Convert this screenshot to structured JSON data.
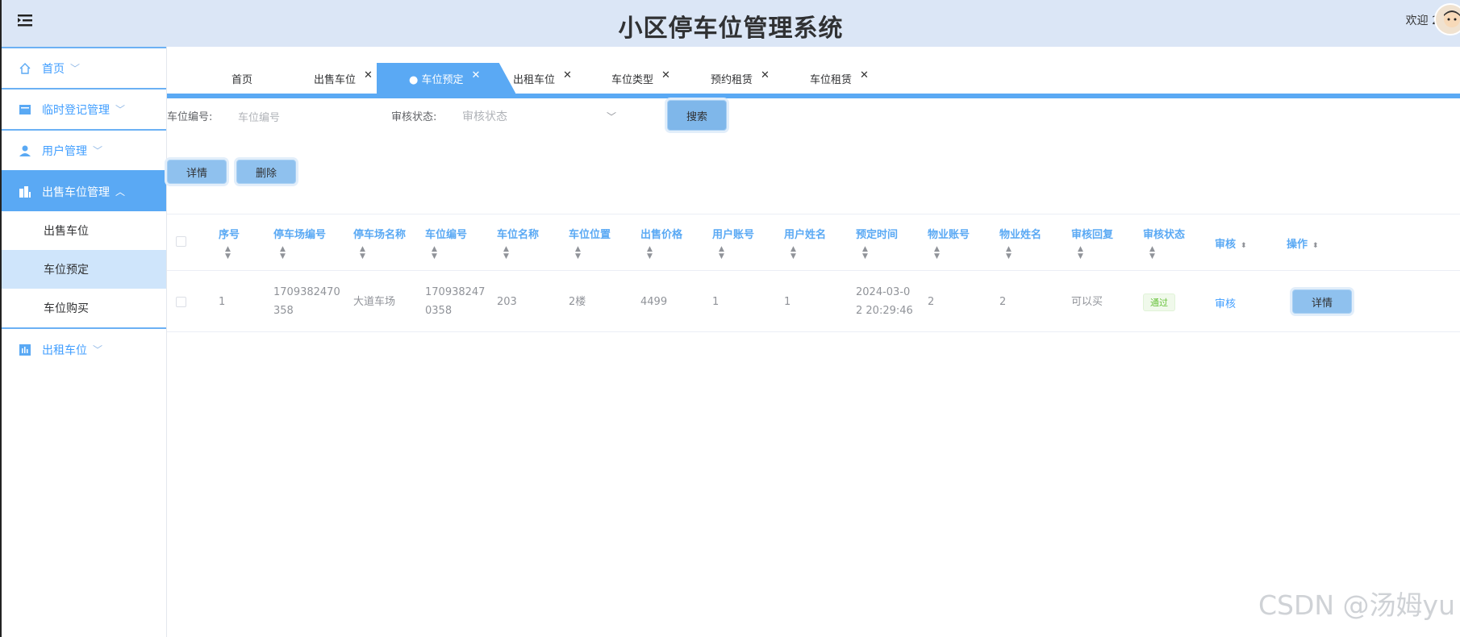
{
  "header": {
    "title": "小区停车位管理系统",
    "welcome": "欢迎 2"
  },
  "sidebar": {
    "items": [
      {
        "label": "首页",
        "icon": "home-icon"
      },
      {
        "label": "临时登记管理",
        "icon": "register-icon"
      },
      {
        "label": "用户管理",
        "icon": "user-icon"
      },
      {
        "label": "出售车位管理",
        "icon": "building-icon",
        "active": true
      },
      {
        "label": "出租车位",
        "icon": "chart-icon"
      }
    ],
    "subitems": [
      {
        "label": "出售车位"
      },
      {
        "label": "车位预定",
        "selected": true
      },
      {
        "label": "车位购买"
      }
    ]
  },
  "tabs": [
    {
      "label": "首页"
    },
    {
      "label": "出售车位"
    },
    {
      "label": "● 车位预定",
      "active": true
    },
    {
      "label": "出租车位"
    },
    {
      "label": "车位类型"
    },
    {
      "label": "预约租赁"
    },
    {
      "label": "车位租赁"
    }
  ],
  "search": {
    "spot_label": "车位编号:",
    "spot_placeholder": "车位编号",
    "status_label": "审核状态:",
    "status_placeholder": "审核状态",
    "button": "搜索"
  },
  "actions": {
    "detail": "详情",
    "delete": "删除"
  },
  "table": {
    "columns": [
      "序号",
      "停车场编号",
      "停车场名称",
      "车位编号",
      "车位名称",
      "车位位置",
      "出售价格",
      "用户账号",
      "用户姓名",
      "预定时间",
      "物业账号",
      "物业姓名",
      "审核回复",
      "审核状态",
      "审核",
      "操作"
    ],
    "rows": [
      {
        "index": "1",
        "lot_no_1": "1709382470",
        "lot_no_2": "358",
        "lot_name": "大道车场",
        "spot_no_1": "170938247",
        "spot_no_2": "0358",
        "spot_name": "203",
        "position": "2楼",
        "price": "4499",
        "user_account": "1",
        "user_name": "1",
        "time_1": "2024-03-0",
        "time_2": "2 20:29:46",
        "pm_account": "2",
        "pm_name": "2",
        "reply": "可以买",
        "status": "通过",
        "review": "审核",
        "op": "详情"
      }
    ]
  },
  "watermark": "CSDN @汤姆yu",
  "colors": {
    "accent": "#5aa9f4",
    "header_bg": "#dbe6f6",
    "success": "#67c23a"
  }
}
